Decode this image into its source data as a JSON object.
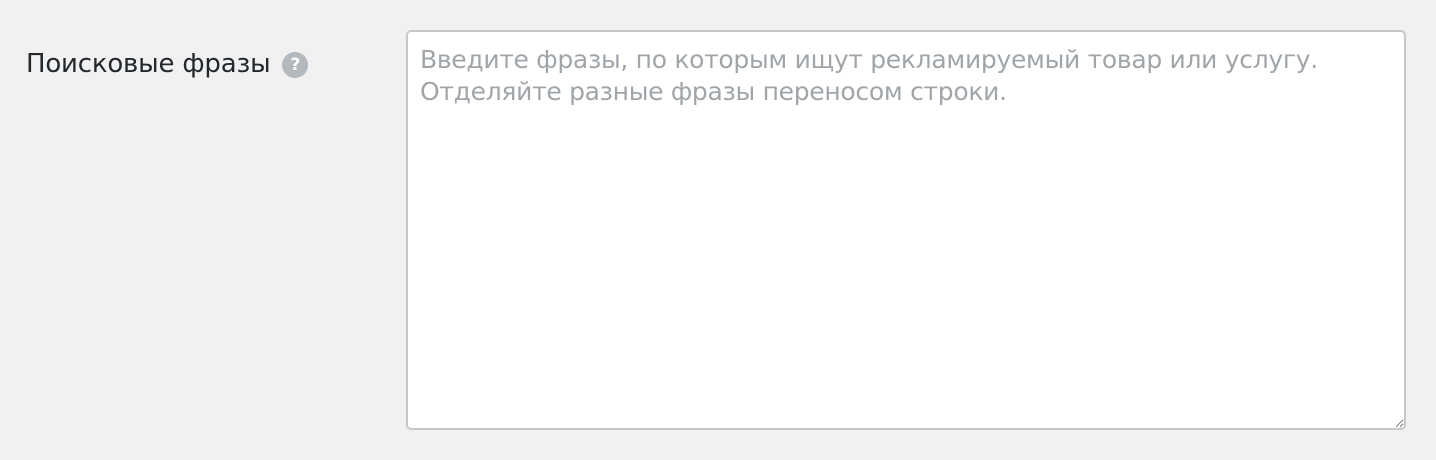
{
  "form": {
    "search_phrases": {
      "label": "Поисковые фразы",
      "help_icon_glyph": "?",
      "help_icon": "question-circle-icon",
      "placeholder": "Введите фразы, по которым ищут рекламируемый товар или услугу.\nОтделяйте разные фразы переносом строки.",
      "value": ""
    }
  },
  "colors": {
    "page_background": "#f1f1f1",
    "label_text": "#23282d",
    "help_icon_background": "#b4b9be",
    "textarea_border": "#c7c7c7",
    "placeholder_text": "#a0a5aa"
  }
}
